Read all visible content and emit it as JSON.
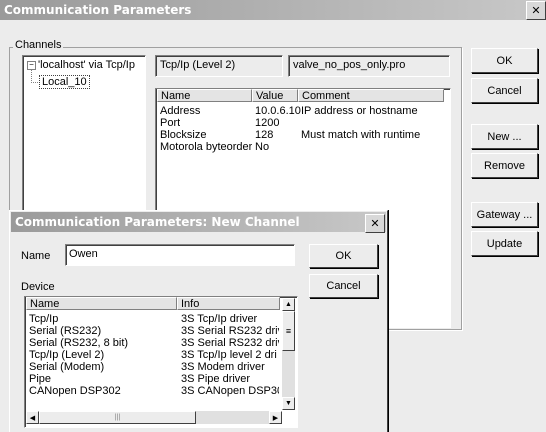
{
  "main_dialog": {
    "title": "Communication Parameters",
    "channels_label": "Channels",
    "tree": {
      "root": "'localhost' via Tcp/Ip",
      "child": "Local_10"
    },
    "driver_field": "Tcp/Ip (Level 2)",
    "file_field": "valve_no_pos_only.pro",
    "table": {
      "headers": [
        "Name",
        "Value",
        "Comment"
      ],
      "rows": [
        [
          "Address",
          "10.0.6.10",
          "IP address or hostname"
        ],
        [
          "Port",
          "1200",
          ""
        ],
        [
          "Blocksize",
          "128",
          "Must match with runtime"
        ],
        [
          "Motorola byteorder",
          "No",
          ""
        ]
      ]
    },
    "buttons": {
      "ok": "OK",
      "cancel": "Cancel",
      "new": "New ...",
      "remove": "Remove",
      "gateway": "Gateway ...",
      "update": "Update"
    }
  },
  "new_channel_dialog": {
    "title": "Communication Parameters: New Channel",
    "name_label": "Name",
    "name_value": "Owen",
    "device_label": "Device",
    "ok": "OK",
    "cancel": "Cancel",
    "device_list": {
      "headers": [
        "Name",
        "Info"
      ],
      "rows": [
        [
          "Tcp/Ip",
          "3S Tcp/Ip driver"
        ],
        [
          "Serial (RS232)",
          "3S Serial RS232 driv"
        ],
        [
          "Serial (RS232, 8 bit)",
          "3S Serial RS232 driv"
        ],
        [
          "Tcp/Ip (Level 2)",
          "3S Tcp/Ip level 2 dri"
        ],
        [
          "Serial (Modem)",
          "3S Modem driver"
        ],
        [
          "Pipe",
          "3S Pipe driver"
        ],
        [
          "CANopen DSP302",
          "3S CANopen DSP30"
        ]
      ],
      "scroll_up": "▲",
      "scroll_down": "▼",
      "scroll_left": "◀",
      "scroll_right": "▶",
      "grip": "≡",
      "hgrip": "|||"
    }
  },
  "close_glyph": "✕"
}
